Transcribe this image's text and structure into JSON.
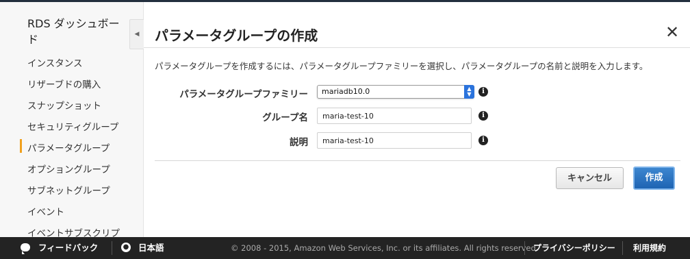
{
  "sidebar": {
    "title": "RDS ダッシュボード",
    "items": [
      {
        "label": "インスタンス",
        "active": false
      },
      {
        "label": "リザーブドの購入",
        "active": false
      },
      {
        "label": "スナップショット",
        "active": false
      },
      {
        "label": "セキュリティグループ",
        "active": false
      },
      {
        "label": "パラメータグループ",
        "active": true
      },
      {
        "label": "オプショングループ",
        "active": false
      },
      {
        "label": "サブネットグループ",
        "active": false
      },
      {
        "label": "イベント",
        "active": false
      },
      {
        "label": "イベントサブスクリプ",
        "active": false
      }
    ],
    "collapse_icon": "chevron-left-icon"
  },
  "modal": {
    "title": "パラメータグループの作成",
    "close_label": "✕",
    "description": "パラメータグループを作成するには、パラメータグループファミリーを選択し、パラメータグループの名前と説明を入力します。",
    "fields": {
      "family": {
        "label": "パラメータグループファミリー",
        "value": "mariadb10.0"
      },
      "name": {
        "label": "グループ名",
        "value": "maria-test-10"
      },
      "description": {
        "label": "説明",
        "value": "maria-test-10"
      }
    },
    "info_icon_label": "i",
    "cancel_label": "キャンセル",
    "create_label": "作成"
  },
  "footer": {
    "feedback_label": "フィードバック",
    "language_label": "日本語",
    "copyright": "© 2008 - 2015, Amazon Web Services, Inc. or its affiliates. All rights reserved.",
    "privacy_label": "プライバシーポリシー",
    "terms_label": "利用規約"
  },
  "colors": {
    "accent_active": "#f0a01d",
    "primary_button": "#1f64b3",
    "footer_bg": "#232323"
  }
}
